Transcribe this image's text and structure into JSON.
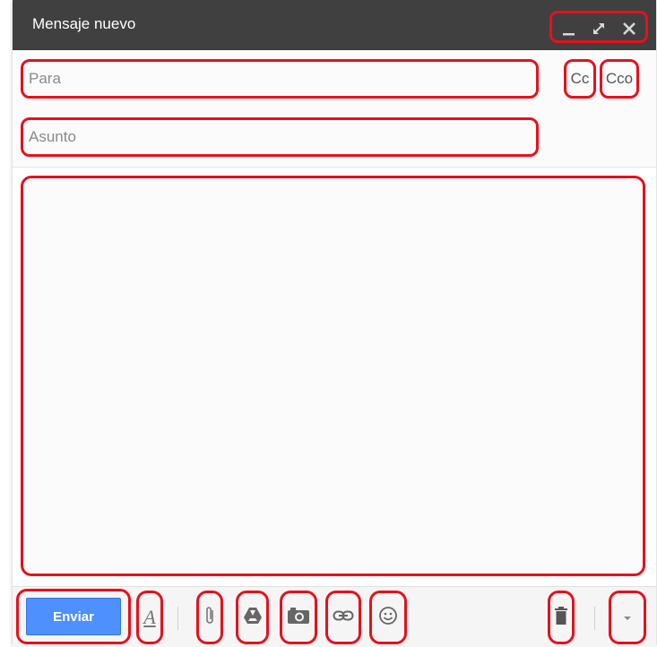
{
  "window": {
    "title": "Mensaje nuevo",
    "controls": [
      "minimize-icon",
      "expand-icon",
      "close-icon"
    ]
  },
  "recipients": {
    "to_placeholder": "Para",
    "cc_label": "Cc",
    "bcc_label": "Cco"
  },
  "subject": {
    "placeholder": "Asunto"
  },
  "toolbar": {
    "send_label": "Enviar",
    "format_glyph": "A",
    "icons": [
      "format-text-icon",
      "attach-icon",
      "drive-icon",
      "photo-icon",
      "link-icon",
      "emoji-icon",
      "trash-icon",
      "more-options-icon"
    ]
  },
  "colors": {
    "titlebar": "#404040",
    "send_button": "#4d90fe",
    "highlight_outline": "#e8101b"
  }
}
